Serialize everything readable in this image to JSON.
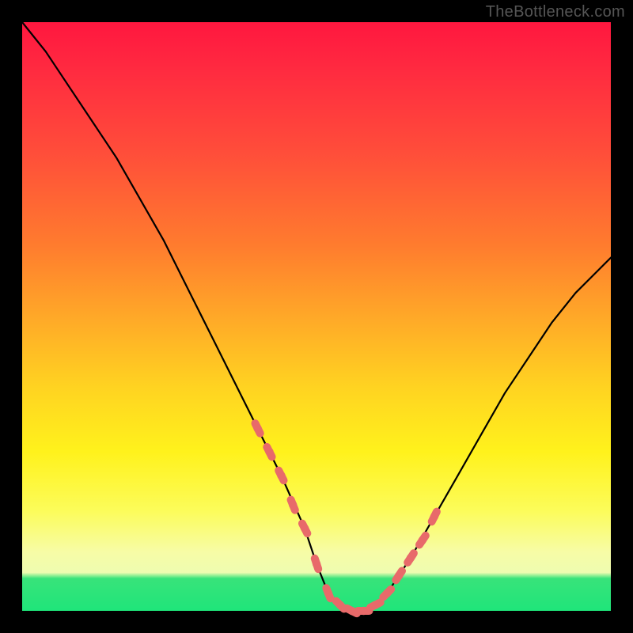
{
  "watermark": "TheBottleneck.com",
  "chart_data": {
    "type": "line",
    "title": "",
    "xlabel": "",
    "ylabel": "",
    "xlim": [
      0,
      100
    ],
    "ylim": [
      0,
      100
    ],
    "grid": false,
    "series": [
      {
        "name": "bottleneck-curve",
        "x": [
          0,
          4,
          8,
          12,
          16,
          20,
          24,
          28,
          32,
          36,
          40,
          44,
          48,
          50,
          52,
          54,
          56,
          58,
          60,
          62,
          66,
          70,
          74,
          78,
          82,
          86,
          90,
          94,
          98,
          100
        ],
        "y": [
          100,
          95,
          89,
          83,
          77,
          70,
          63,
          55,
          47,
          39,
          31,
          23,
          14,
          8,
          3,
          1,
          0,
          0,
          1,
          3,
          9,
          16,
          23,
          30,
          37,
          43,
          49,
          54,
          58,
          60
        ]
      }
    ],
    "markers": {
      "name": "highlight-points",
      "color": "#e86a6a",
      "x": [
        40,
        42,
        44,
        46,
        48,
        50,
        52,
        54,
        56,
        58,
        60,
        62,
        64,
        66,
        68,
        70
      ],
      "y": [
        31,
        27,
        23,
        18,
        14,
        8,
        3,
        1,
        0,
        0,
        1,
        3,
        6,
        9,
        12,
        16
      ]
    },
    "baseline": {
      "name": "green-band",
      "y": [
        0,
        5
      ]
    }
  }
}
